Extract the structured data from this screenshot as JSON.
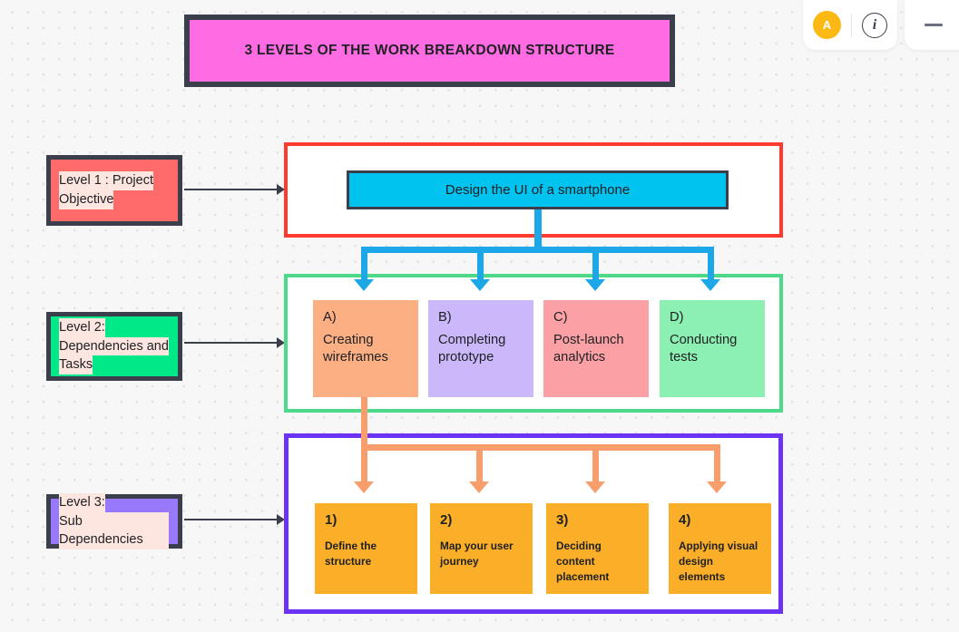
{
  "topbar": {
    "avatar_initial": "A",
    "info_icon": "info-icon",
    "minimize_icon": "minimize-icon"
  },
  "title_banner": {
    "text": "3 LEVELS OF THE WORK BREAKDOWN STRUCTURE",
    "fill": "#FF6BE2",
    "border": "#3A3F4B"
  },
  "levels": [
    {
      "id": "level1",
      "label_line1": "Level 1 : Project",
      "label_line2": "Objective",
      "label_fill": "#FF6B6B",
      "container_border": "#FF3B30"
    },
    {
      "id": "level2",
      "label_line1": "Level 2:",
      "label_line2": "Dependencies and",
      "label_line3": "Tasks",
      "label_fill": "#00E887",
      "container_border": "#4CD98A"
    },
    {
      "id": "level3",
      "label_line1": "Level 3:",
      "label_line2": "Sub Dependencies",
      "label_fill": "#9879FB",
      "container_border": "#6D33F5"
    }
  ],
  "root": {
    "text": "Design the UI of a smartphone",
    "fill": "#00C3F0"
  },
  "level2_cards": [
    {
      "tag": "A)",
      "line1": "Creating",
      "line2": "wireframes",
      "fill": "#FBAF82"
    },
    {
      "tag": "B)",
      "line1": "Completing",
      "line2": "prototype",
      "fill": "#CBB8FB"
    },
    {
      "tag": "C)",
      "line1": "Post-launch",
      "line2": "analytics",
      "fill": "#FBA0A4"
    },
    {
      "tag": "D)",
      "line1": "Conducting",
      "line2": "tests",
      "fill": "#8BF0B2"
    }
  ],
  "level3_cards": [
    {
      "num": "1)",
      "body": "Define the structure",
      "fill": "#FBAE27"
    },
    {
      "num": "2)",
      "body": "Map your user journey",
      "fill": "#FBAE27"
    },
    {
      "num": "3)",
      "body": "Deciding content placement",
      "fill": "#FBAE27"
    },
    {
      "num": "4)",
      "body": "Applying visual design elements",
      "fill": "#FBAE27"
    }
  ],
  "connectors": {
    "level1_to_level2_color": "#1BA7E8",
    "level2_to_level3_color": "#F79E6C",
    "pointer_color": "#3A3F4B"
  }
}
